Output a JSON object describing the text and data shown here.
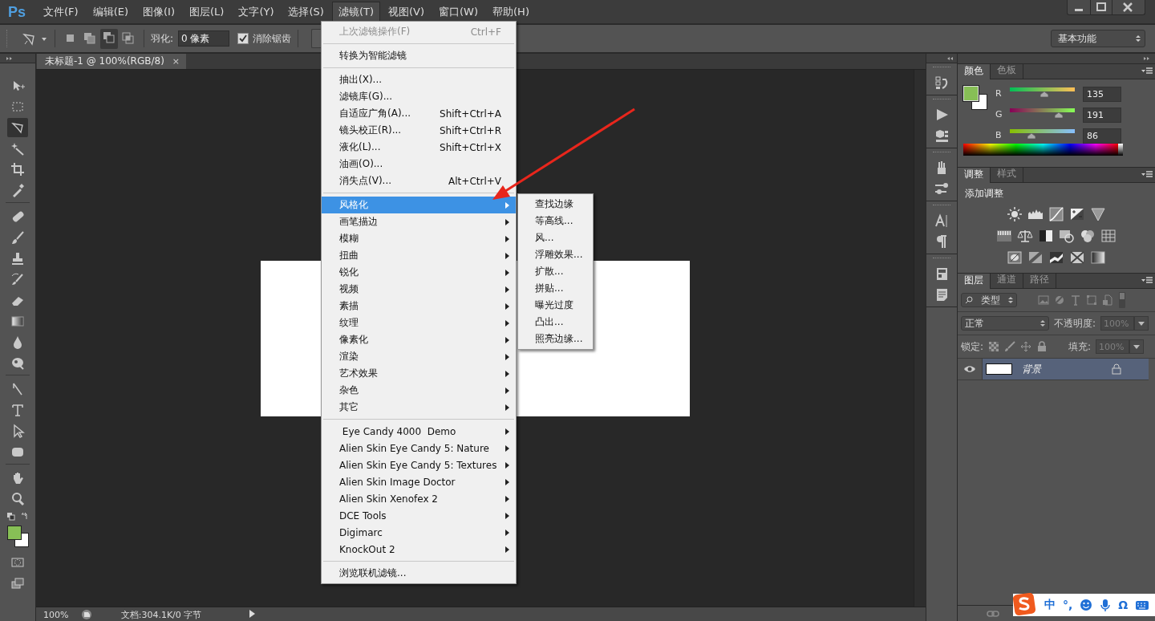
{
  "app_logo": "Ps",
  "menu_bar": [
    {
      "label": "文件(F)",
      "selected": false
    },
    {
      "label": "编辑(E)",
      "selected": false
    },
    {
      "label": "图像(I)",
      "selected": false
    },
    {
      "label": "图层(L)",
      "selected": false
    },
    {
      "label": "文字(Y)",
      "selected": false
    },
    {
      "label": "选择(S)",
      "selected": false
    },
    {
      "label": "滤镜(T)",
      "selected": true
    },
    {
      "label": "视图(V)",
      "selected": false
    },
    {
      "label": "窗口(W)",
      "selected": false
    },
    {
      "label": "帮助(H)",
      "selected": false
    }
  ],
  "options_bar": {
    "feather_label": "羽化:",
    "feather_value": "0 像素",
    "antialias": {
      "label": "消除锯齿",
      "checked": true
    },
    "workspace": "基本功能"
  },
  "toolbox": {
    "tools": [
      {
        "selected": false
      },
      {
        "selected": false
      },
      {
        "selected": true
      },
      {
        "selected": false
      },
      {
        "selected": false
      },
      {
        "selected": false
      },
      {
        "selected": false
      },
      {
        "selected": false
      },
      {
        "selected": false
      },
      {
        "selected": false
      },
      {
        "selected": false
      },
      {
        "selected": false
      },
      {
        "selected": false
      },
      {
        "selected": false
      },
      {
        "selected": false
      },
      {
        "selected": false
      },
      {
        "selected": false
      },
      {
        "selected": false
      },
      {
        "selected": false
      },
      {
        "selected": false
      }
    ]
  },
  "document_tab": {
    "title": "未标题-1 @ 100%(RGB/8)",
    "close": "×"
  },
  "status_bar": {
    "zoom": "100%",
    "doc_info": "文档:304.1K/0 字节"
  },
  "filter_menu": {
    "groups": [
      [
        {
          "label": "上次滤镜操作(F)",
          "shortcut": "Ctrl+F",
          "disabled": true,
          "selected": false,
          "submenu": false
        }
      ],
      [
        {
          "label": "转换为智能滤镜",
          "disabled": false,
          "selected": false,
          "submenu": false
        }
      ],
      [
        {
          "label": "抽出(X)...",
          "disabled": false,
          "selected": false,
          "submenu": false
        },
        {
          "label": "滤镜库(G)...",
          "disabled": false,
          "selected": false,
          "submenu": false
        },
        {
          "label": "自适应广角(A)...",
          "shortcut": "Shift+Ctrl+A",
          "disabled": false,
          "selected": false,
          "submenu": false
        },
        {
          "label": "镜头校正(R)...",
          "shortcut": "Shift+Ctrl+R",
          "disabled": false,
          "selected": false,
          "submenu": false
        },
        {
          "label": "液化(L)...",
          "shortcut": "Shift+Ctrl+X",
          "disabled": false,
          "selected": false,
          "submenu": false
        },
        {
          "label": "油画(O)...",
          "disabled": false,
          "selected": false,
          "submenu": false
        },
        {
          "label": "消失点(V)...",
          "shortcut": "Alt+Ctrl+V",
          "disabled": false,
          "selected": false,
          "submenu": false
        }
      ],
      [
        {
          "label": "风格化",
          "disabled": false,
          "selected": true,
          "submenu": true
        },
        {
          "label": "画笔描边",
          "disabled": false,
          "selected": false,
          "submenu": true
        },
        {
          "label": "模糊",
          "disabled": false,
          "selected": false,
          "submenu": true
        },
        {
          "label": "扭曲",
          "disabled": false,
          "selected": false,
          "submenu": true
        },
        {
          "label": "锐化",
          "disabled": false,
          "selected": false,
          "submenu": true
        },
        {
          "label": "视频",
          "disabled": false,
          "selected": false,
          "submenu": true
        },
        {
          "label": "素描",
          "disabled": false,
          "selected": false,
          "submenu": true
        },
        {
          "label": "纹理",
          "disabled": false,
          "selected": false,
          "submenu": true
        },
        {
          "label": "像素化",
          "disabled": false,
          "selected": false,
          "submenu": true
        },
        {
          "label": "渲染",
          "disabled": false,
          "selected": false,
          "submenu": true
        },
        {
          "label": "艺术效果",
          "disabled": false,
          "selected": false,
          "submenu": true
        },
        {
          "label": "杂色",
          "disabled": false,
          "selected": false,
          "submenu": true
        },
        {
          "label": "其它",
          "disabled": false,
          "selected": false,
          "submenu": true
        }
      ],
      [
        {
          "label": " Eye Candy 4000  Demo",
          "disabled": false,
          "selected": false,
          "submenu": true
        },
        {
          "label": "Alien Skin Eye Candy 5: Nature",
          "disabled": false,
          "selected": false,
          "submenu": true
        },
        {
          "label": "Alien Skin Eye Candy 5: Textures",
          "disabled": false,
          "selected": false,
          "submenu": true
        },
        {
          "label": "Alien Skin Image Doctor",
          "disabled": false,
          "selected": false,
          "submenu": true
        },
        {
          "label": "Alien Skin Xenofex 2",
          "disabled": false,
          "selected": false,
          "submenu": true
        },
        {
          "label": "DCE Tools",
          "disabled": false,
          "selected": false,
          "submenu": true
        },
        {
          "label": "Digimarc",
          "disabled": false,
          "selected": false,
          "submenu": true
        },
        {
          "label": "KnockOut 2",
          "disabled": false,
          "selected": false,
          "submenu": true
        }
      ],
      [
        {
          "label": "浏览联机滤镜...",
          "disabled": false,
          "selected": false,
          "submenu": false
        }
      ]
    ]
  },
  "stylize_submenu": {
    "items": [
      {
        "label": "查找边缘"
      },
      {
        "label": "等高线..."
      },
      {
        "label": "风..."
      },
      {
        "label": "浮雕效果..."
      },
      {
        "label": "扩散..."
      },
      {
        "label": "拼贴..."
      },
      {
        "label": "曝光过度"
      },
      {
        "label": "凸出..."
      },
      {
        "label": "照亮边缘..."
      }
    ]
  },
  "color_panel": {
    "tabs": [
      {
        "label": "颜色",
        "selected": true
      },
      {
        "label": "色板",
        "selected": false
      }
    ],
    "channels": [
      {
        "name": "R",
        "value": "135",
        "level": 0.529
      },
      {
        "name": "G",
        "value": "191",
        "level": 0.749
      },
      {
        "name": "B",
        "value": "86",
        "level": 0.337
      }
    ]
  },
  "adjustments_panel": {
    "tabs": [
      {
        "label": "调整",
        "selected": true
      },
      {
        "label": "样式",
        "selected": false
      }
    ],
    "title": "添加调整"
  },
  "layers_panel": {
    "tabs": [
      {
        "label": "图层",
        "selected": true
      },
      {
        "label": "通道",
        "selected": false
      },
      {
        "label": "路径",
        "selected": false
      }
    ],
    "filter": "类型",
    "blend_mode": "正常",
    "opacity_label": "不透明度:",
    "opacity": "100%",
    "lock_label": "锁定:",
    "fill_label": "填充:",
    "fill": "100%",
    "layers": [
      {
        "name": "背景",
        "visible": true,
        "selected": true,
        "locked": true
      }
    ]
  },
  "ime_bar": {
    "mode": "中",
    "punct": "°,",
    "symbol": "Ω"
  }
}
